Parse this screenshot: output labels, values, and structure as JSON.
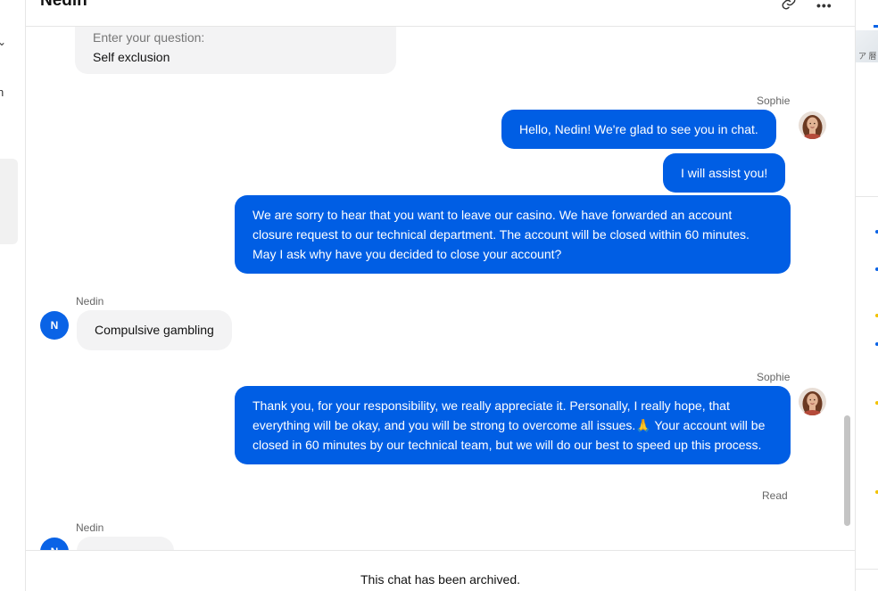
{
  "header": {
    "title": "Nedin",
    "link_icon": "link-icon",
    "more_icon": "more-horizontal-icon",
    "more_glyph": "•••"
  },
  "sidebar_left": {
    "chevron_glyph": "⌄",
    "partial_text": "n"
  },
  "form_card": {
    "question_label": "Enter your question:",
    "question_value": "Self exclusion"
  },
  "messages": [
    {
      "type": "agent",
      "sender": "Sophie",
      "texts": [
        "Hello, Nedin! We're glad to see you in chat.",
        "I will assist you!",
        "We are sorry to hear that you want to leave our casino. We have forwarded an account closure request to our technical department. The account will be closed within 60 minutes. May I ask why have you decided to close your account?"
      ]
    },
    {
      "type": "visitor",
      "sender": "Nedin",
      "avatar_letter": "N",
      "texts": [
        "Compulsive gambling"
      ]
    },
    {
      "type": "agent",
      "sender": "Sophie",
      "status": "Read",
      "texts": [
        "Thank you, for your responsibility, we really appreciate it. Personally, I really hope, that everything will be okay, and you will be strong to overcome all issues.🙏 Your account will be closed in 60 minutes by our technical team, but we will do our best to speed up this process."
      ]
    },
    {
      "type": "visitor",
      "sender": "Nedin",
      "avatar_letter": "N",
      "texts": [
        ""
      ]
    }
  ],
  "footer": {
    "archived_text": "This chat has been archived."
  },
  "right_strip": {
    "map_text": "ア 暦"
  },
  "colors": {
    "agent_bubble": "#005ee4",
    "visitor_bubble": "#f3f3f4",
    "visitor_avatar": "#0a63e6"
  }
}
